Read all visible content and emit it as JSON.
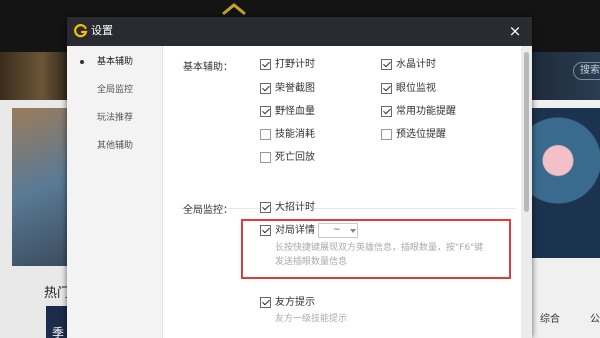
{
  "background": {
    "search_text": "搜索英",
    "hot_label": "热门",
    "card_label": "季",
    "tab_right_1": "综合",
    "tab_right_2": "公"
  },
  "dialog": {
    "title": "设置",
    "logo_icon": "g-logo-icon",
    "close_symbol": "×"
  },
  "sidebar": {
    "items": [
      {
        "label": "基本辅助",
        "active": true
      },
      {
        "label": "全局监控",
        "active": false
      },
      {
        "label": "玩法推荐",
        "active": false
      },
      {
        "label": "其他辅助",
        "active": false
      }
    ]
  },
  "basic": {
    "section_label": "基本辅助：",
    "options": [
      {
        "label": "打野计时",
        "checked": true
      },
      {
        "label": "水晶计时",
        "checked": true
      },
      {
        "label": "荣誉截图",
        "checked": true
      },
      {
        "label": "眼位监视",
        "checked": true
      },
      {
        "label": "野怪血量",
        "checked": true
      },
      {
        "label": "常用功能提醒",
        "checked": true
      },
      {
        "label": "技能消耗",
        "checked": false
      },
      {
        "label": "预选位提醒",
        "checked": false
      },
      {
        "label": "死亡回放",
        "checked": false
      }
    ]
  },
  "global": {
    "section_label": "全局监控：",
    "ult_timer": {
      "label": "大招计时",
      "checked": true
    },
    "opponent_detail": {
      "label": "对局详情",
      "checked": true,
      "dropdown_value": "~",
      "hint_line1": "长按快捷键展现双方英雄信息，插眼数量，按\"F6\"键",
      "hint_line2": "发送插眼数量信息"
    },
    "ally_hint": {
      "label": "友方提示",
      "checked": true,
      "hint": "友方一级技能提示"
    }
  },
  "colors": {
    "titlebar": "#2a2b30",
    "highlight_box": "#e23b3b",
    "hint_text": "#aaaaaa"
  }
}
